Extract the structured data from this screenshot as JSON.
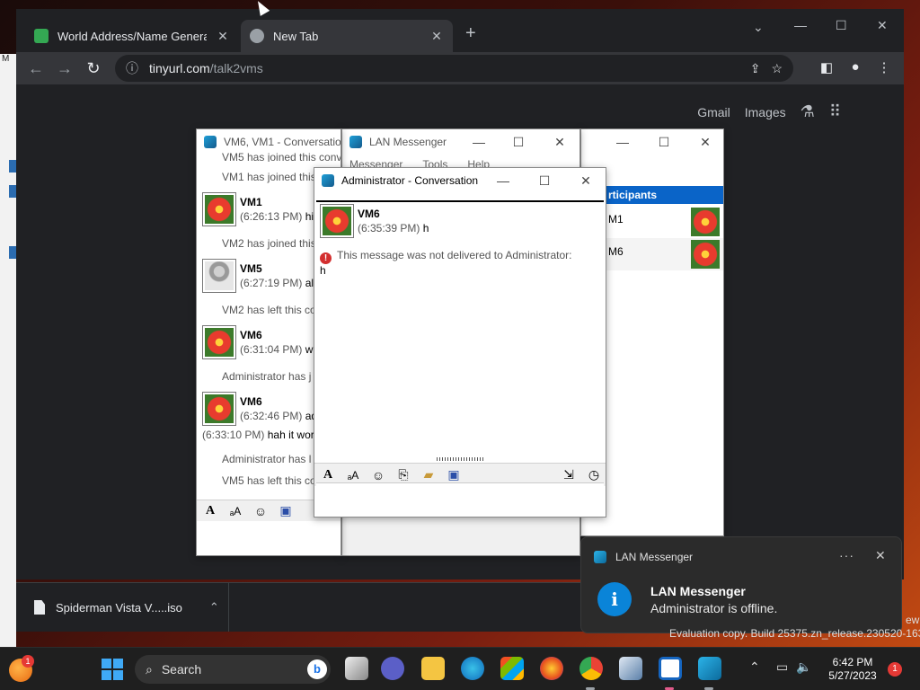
{
  "browser": {
    "tabs": [
      {
        "title": "World Address/Name Generator",
        "favicon_color": "#34a853",
        "active": false
      },
      {
        "title": "New Tab",
        "favicon_color": "#9aa0a6",
        "active": true
      }
    ],
    "new_tab_label": "+",
    "url_host": "tinyurl.com",
    "url_path": "/talk2vms",
    "ntp_links": [
      "Gmail",
      "Images"
    ]
  },
  "download": {
    "filename": "Spiderman Vista V.....iso"
  },
  "conv1": {
    "title": "VM6, VM1 - Conversatio",
    "lines": [
      "VM5 has joined this conv",
      "VM1 has joined this conv",
      "VM2 has joined this co",
      "VM2 has left this co",
      "Administrator has j",
      "Administrator has l",
      "VM5 has left this co"
    ],
    "entries": [
      {
        "name": "VM1",
        "time": "(6:26:13 PM)",
        "text": "hiy"
      },
      {
        "name": "VM5",
        "time": "(6:27:19 PM)",
        "text": "alr"
      },
      {
        "name": "VM6",
        "time": "(6:31:04 PM)",
        "text": "wh"
      },
      {
        "name": "VM6",
        "time": "(6:32:46 PM)",
        "text": "ad"
      }
    ],
    "extra_time": "(6:33:10 PM)",
    "extra_text": "hah it work"
  },
  "lan_main": {
    "title": "LAN Messenger",
    "menu": [
      "Messenger",
      "Tools",
      "Help"
    ]
  },
  "participants": {
    "header": "rticipants",
    "rows": [
      "M1",
      "M6"
    ]
  },
  "admin_conv": {
    "title": "Administrator - Conversation",
    "sender": "VM6",
    "time": "(6:35:39 PM)",
    "message": "h",
    "error": "This message was not delivered to Administrator:",
    "error_body": "h"
  },
  "toast": {
    "app": "LAN Messenger",
    "title": "LAN Messenger",
    "body": "Administrator is offline.",
    "more": "···",
    "close": "✕"
  },
  "watermark": "Evaluation copy. Build 25375.zn_release.230520-1632",
  "watermark_edge": "ew",
  "taskbar": {
    "search": "Search",
    "weather_badge": "1",
    "time": "6:42 PM",
    "date": "5/27/2023",
    "notif_count": "1"
  }
}
